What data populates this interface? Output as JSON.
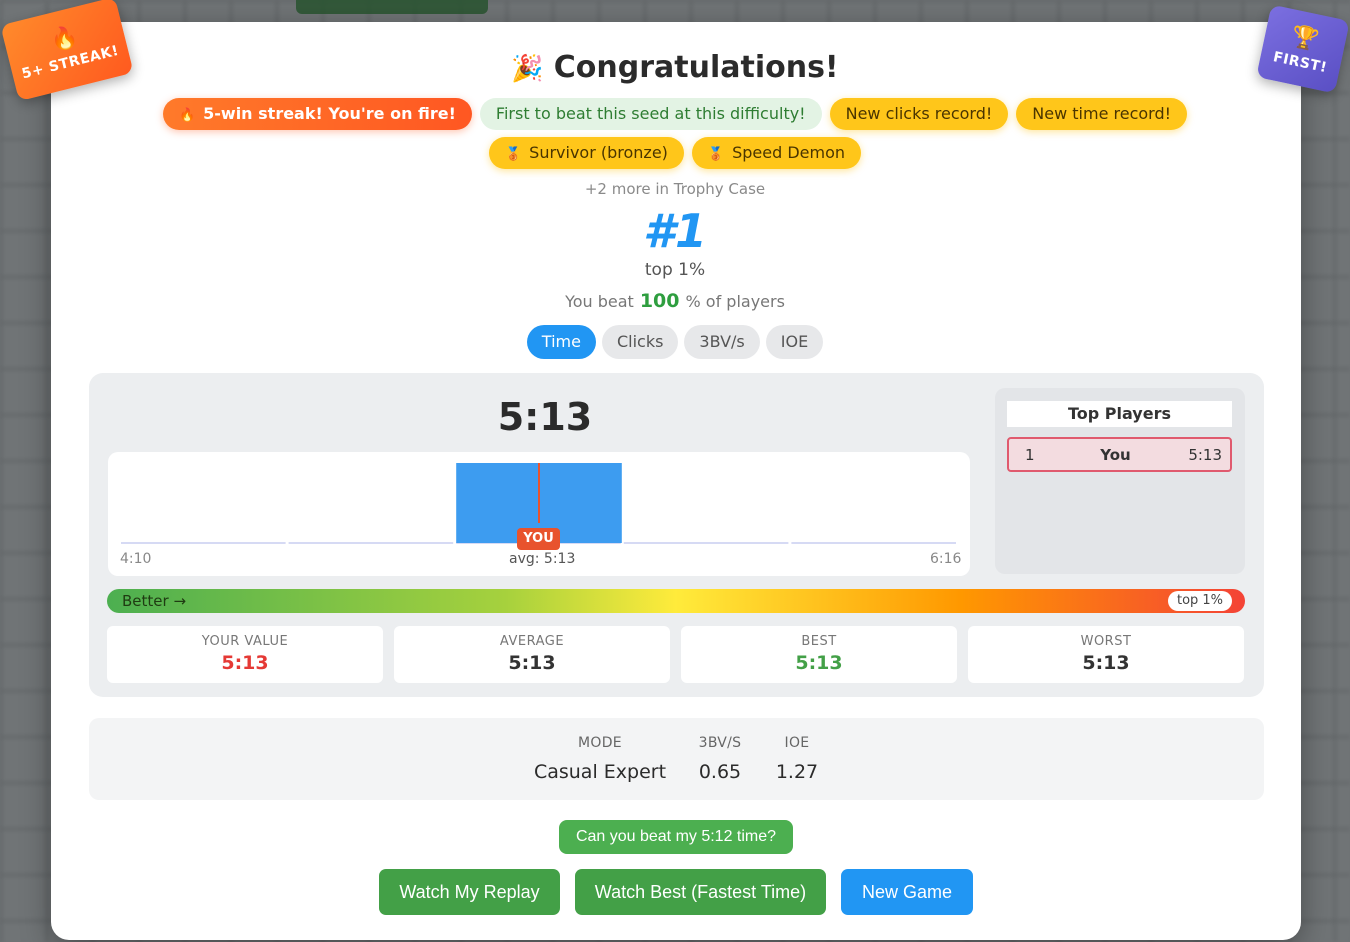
{
  "corner_badges": {
    "streak": {
      "icon": "fire-icon",
      "label": "5+ STREAK!"
    },
    "first": {
      "icon": "trophy-icon",
      "label": "FIRST!"
    }
  },
  "header": {
    "title": "Congratulations!",
    "title_icon": "party-popper-icon"
  },
  "achievements": {
    "row1": [
      {
        "label": "5-win streak! You're on fire!",
        "icon": "fire-icon",
        "style": "fire"
      },
      {
        "label": "First to beat this seed at this difficulty!",
        "style": "green"
      },
      {
        "label": "New clicks record!",
        "style": "gold"
      },
      {
        "label": "New time record!",
        "style": "gold"
      }
    ],
    "row2": [
      {
        "label": "Survivor (bronze)",
        "icon": "bronze-medal-icon",
        "style": "gold"
      },
      {
        "label": "Speed Demon",
        "icon": "bronze-medal-icon",
        "style": "gold"
      }
    ],
    "more": "+2 more in Trophy Case"
  },
  "rank": {
    "value": "#1",
    "top_percent": "top 1%",
    "beat_prefix": "You beat",
    "beat_value": "100",
    "beat_suffix": "% of players"
  },
  "tabs": [
    {
      "label": "Time",
      "active": true
    },
    {
      "label": "Clicks",
      "active": false
    },
    {
      "label": "3BV/s",
      "active": false
    },
    {
      "label": "IOE",
      "active": false
    }
  ],
  "histogram": {
    "value": "5:13",
    "min_label": "4:10",
    "max_label": "6:16",
    "avg_label": "avg: 5:13",
    "you_label": "YOU",
    "bins": [
      0,
      0,
      1,
      0,
      0
    ],
    "you_position": 0.5
  },
  "leaderboard": {
    "title": "Top Players",
    "rows": [
      {
        "rank": "1",
        "name": "You",
        "time": "5:13"
      }
    ]
  },
  "scale": {
    "left_label": "Better →",
    "marker_label": "top 1%",
    "marker_position": 0.99
  },
  "metrics": [
    {
      "label": "YOUR VALUE",
      "value": "5:13",
      "color": "#e53935"
    },
    {
      "label": "AVERAGE",
      "value": "5:13",
      "color": "#333333"
    },
    {
      "label": "BEST",
      "value": "5:13",
      "color": "#43a047"
    },
    {
      "label": "WORST",
      "value": "5:13",
      "color": "#333333"
    }
  ],
  "game_info": {
    "mode_label": "MODE",
    "mode_value": "Casual Expert",
    "bv_label": "3BV/S",
    "bv_value": "0.65",
    "ioe_label": "IOE",
    "ioe_value": "1.27"
  },
  "actions": {
    "challenge": "Can you beat my 5:12 time?",
    "watch_replay": "Watch My Replay",
    "watch_best": "Watch Best (Fastest Time)",
    "new_game": "New Game"
  },
  "colors": {
    "primary": "#2196f3",
    "success": "#43a047",
    "danger": "#e53935",
    "gold": "#ffc61a"
  }
}
